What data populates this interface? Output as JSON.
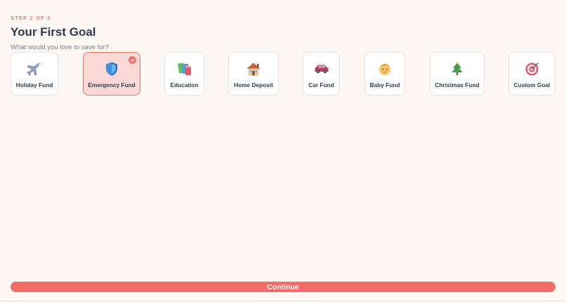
{
  "header": {
    "step": "STEP 2 OF 3",
    "title": "Your First Goal",
    "subtitle": "What would you love to save for?"
  },
  "goals": [
    {
      "label": "Holiday Fund",
      "icon": "airplane-icon",
      "selected": false
    },
    {
      "label": "Emergency Fund",
      "icon": "shield-icon",
      "selected": true
    },
    {
      "label": "Education",
      "icon": "books-icon",
      "selected": false
    },
    {
      "label": "Home Deposit",
      "icon": "house-icon",
      "selected": false
    },
    {
      "label": "Car Fund",
      "icon": "car-icon",
      "selected": false
    },
    {
      "label": "Baby Fund",
      "icon": "baby-icon",
      "selected": false
    },
    {
      "label": "Christmas Fund",
      "icon": "christmas-tree-icon",
      "selected": false
    },
    {
      "label": "Custom Goal",
      "icon": "target-icon",
      "selected": false
    }
  ],
  "footer": {
    "continue_label": "Continue"
  },
  "colors": {
    "accent": "#f26c68",
    "selected_bg": "#fcd9d6",
    "background": "#fdf7f3",
    "text": "#2f3b4c"
  }
}
